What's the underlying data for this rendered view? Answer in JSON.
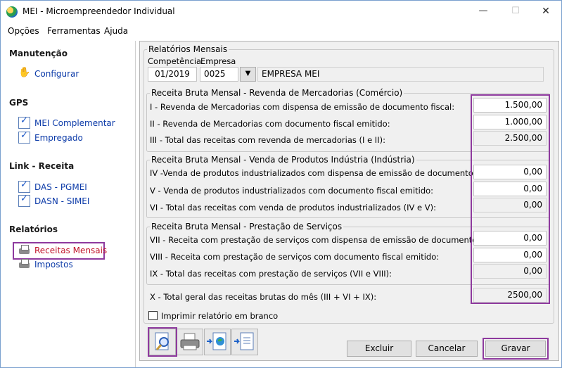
{
  "window": {
    "title": "MEI - Microempreendedor Individual",
    "minimize_icon": "minimize-icon",
    "maximize_icon": "maximize-icon",
    "close_icon": "close-icon"
  },
  "menu": [
    "Opções",
    "Ferramentas",
    "Ajuda"
  ],
  "sidebar": {
    "sections": [
      {
        "title": "Manutenção",
        "items": [
          {
            "label": "Configurar",
            "icon": "hand-icon"
          }
        ]
      },
      {
        "title": "GPS",
        "items": [
          {
            "label": "MEI Complementar",
            "icon": "document-check-icon"
          },
          {
            "label": "Empregado",
            "icon": "document-check-icon"
          }
        ]
      },
      {
        "title": "Link - Receita",
        "items": [
          {
            "label": "DAS - PGMEI",
            "icon": "document-check-icon"
          },
          {
            "label": "DASN - SIMEI",
            "icon": "document-check-icon"
          }
        ]
      },
      {
        "title": "Relatórios",
        "items": [
          {
            "label": "Receitas Mensais",
            "icon": "printer-icon",
            "active": true
          },
          {
            "label": "Impostos",
            "icon": "printer-icon"
          }
        ]
      }
    ]
  },
  "form": {
    "group_title": "Relatórios Mensais",
    "competencia_label": "Competência",
    "competencia_value": "01/2019",
    "empresa_label": "Empresa",
    "empresa_code": "0025",
    "empresa_name": "EMPRESA MEI",
    "sections": [
      {
        "title": "Receita Bruta Mensal - Revenda de Mercadorias (Comércio)",
        "rows": [
          {
            "label": "I - Revenda de Mercadorias com dispensa de emissão de documento fiscal:",
            "value": "1.500,00"
          },
          {
            "label": "II - Revenda de Mercadorias com documento fiscal emitido:",
            "value": "1.000,00"
          },
          {
            "label": "III - Total das receitas com revenda de mercadorias (I e II):",
            "value": "2.500,00"
          }
        ]
      },
      {
        "title": "Receita Bruta Mensal - Venda de Produtos Indústria (Indústria)",
        "rows": [
          {
            "label": "IV -Venda de produtos industrializados com dispensa de emissão de documento fiscal:",
            "value": "0,00"
          },
          {
            "label": "V - Venda de produtos industrializados com documento fiscal emitido:",
            "value": "0,00"
          },
          {
            "label": "VI - Total das receitas com venda de produtos industrializados (IV e V):",
            "value": "0,00"
          }
        ]
      },
      {
        "title": "Receita Bruta Mensal - Prestação de Serviços",
        "rows": [
          {
            "label": "VII - Receita com prestação de serviços com dispensa de emissão de documento fiscal:",
            "value": "0,00"
          },
          {
            "label": "VIII - Receita com prestação de serviços com documento fiscal emitido:",
            "value": "0,00"
          },
          {
            "label": "IX - Total das receitas com prestação de serviços (VII e VIII):",
            "value": "0,00"
          }
        ]
      }
    ],
    "total_label": "X - Total geral das receitas brutas do mês (III + VI + IX):",
    "total_value": "2500,00",
    "print_blank_label": "Imprimir relatório em branco",
    "buttons": {
      "excluir": "Excluir",
      "cancelar": "Cancelar",
      "gravar": "Gravar"
    },
    "tool_icons": [
      "preview-icon",
      "printer-icon",
      "export-web-icon",
      "export-file-icon"
    ]
  },
  "colors": {
    "highlight": "#8e3a9e",
    "link": "#0b3aa8",
    "active_link": "#c0142a"
  }
}
